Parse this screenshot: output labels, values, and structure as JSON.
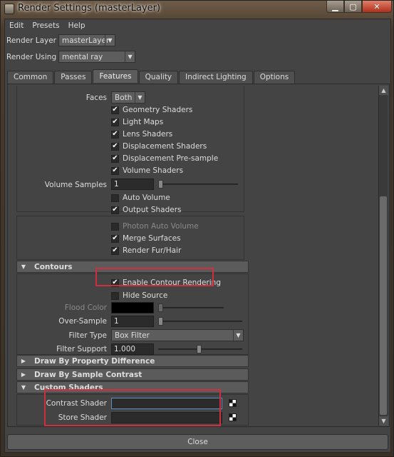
{
  "window": {
    "title": "Render Settings (masterLayer)",
    "min_icon": "minimize-icon",
    "max_icon": "maximize-icon",
    "close_icon": "close-icon"
  },
  "menubar": {
    "items": [
      "Edit",
      "Presets",
      "Help"
    ]
  },
  "render_layer": {
    "label": "Render Layer",
    "value": "masterLayer"
  },
  "render_using": {
    "label": "Render Using",
    "value": "mental ray"
  },
  "tabs": [
    "Common",
    "Passes",
    "Features",
    "Quality",
    "Indirect Lighting",
    "Options"
  ],
  "active_tab": "Features",
  "extra": {
    "faces_label": "Faces",
    "faces_value": "Both",
    "checks": [
      {
        "label": "Geometry Shaders",
        "checked": true
      },
      {
        "label": "Light Maps",
        "checked": true
      },
      {
        "label": "Lens Shaders",
        "checked": true
      },
      {
        "label": "Displacement Shaders",
        "checked": true
      },
      {
        "label": "Displacement Pre-sample",
        "checked": true
      },
      {
        "label": "Volume Shaders",
        "checked": true
      }
    ],
    "volume_samples_label": "Volume Samples",
    "volume_samples_value": "1",
    "auto_volume": {
      "label": "Auto Volume",
      "checked": false
    },
    "output_shaders": {
      "label": "Output Shaders",
      "checked": true
    },
    "photon_auto_volume": {
      "label": "Photon Auto Volume",
      "checked": false
    },
    "merge_surfaces": {
      "label": "Merge Surfaces",
      "checked": true
    },
    "render_fur": {
      "label": "Render Fur/Hair",
      "checked": true
    }
  },
  "contours": {
    "title": "Contours",
    "enable": {
      "label": "Enable Contour Rendering",
      "checked": true
    },
    "hide_source": {
      "label": "Hide Source",
      "checked": false
    },
    "flood_color_label": "Flood Color",
    "over_sample_label": "Over-Sample",
    "over_sample_value": "1",
    "filter_type_label": "Filter Type",
    "filter_type_value": "Box Filter",
    "filter_support_label": "Filter Support",
    "filter_support_value": "1.000"
  },
  "sections": {
    "draw_prop": "Draw By Property Difference",
    "draw_sample": "Draw By Sample Contrast",
    "custom_shaders": "Custom Shaders"
  },
  "custom": {
    "contrast_label": "Contrast Shader",
    "store_label": "Store Shader",
    "contrast_value": "",
    "store_value": ""
  },
  "close_label": "Close",
  "colors": {
    "highlight": "#cf2e3d",
    "panel": "#444444"
  }
}
